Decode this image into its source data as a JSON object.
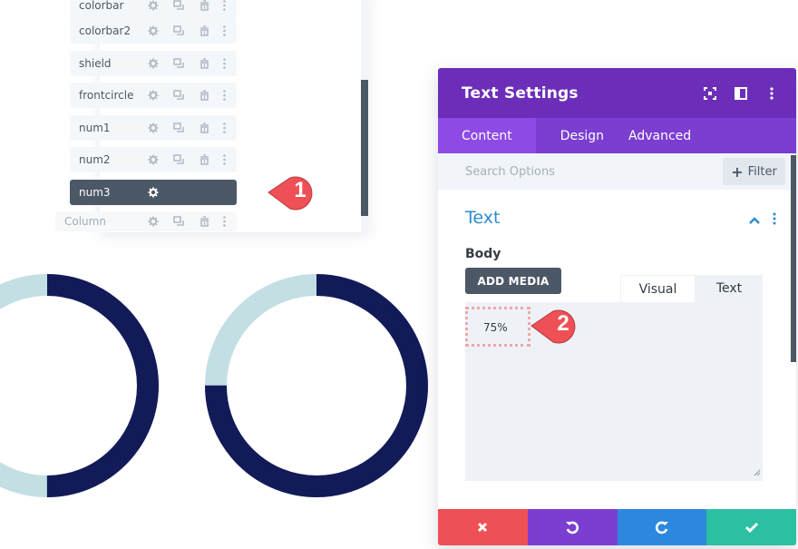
{
  "layers_panel": {
    "items": [
      {
        "label": "colorbar",
        "state": "partial"
      },
      {
        "label": "colorbar2",
        "state": "normal"
      },
      {
        "label": "shield",
        "state": "normal"
      },
      {
        "label": "frontcircle",
        "state": "normal"
      },
      {
        "label": "num1",
        "state": "normal"
      },
      {
        "label": "num2",
        "state": "normal"
      },
      {
        "label": "num3",
        "state": "active"
      },
      {
        "label": "Column",
        "state": "parent"
      }
    ],
    "row_icons": [
      "gear-icon",
      "duplicate-icon",
      "trash-icon",
      "more-vertical-icon"
    ]
  },
  "callouts": [
    {
      "number": "1",
      "color": "#ef5055"
    },
    {
      "number": "2",
      "color": "#ef5055"
    }
  ],
  "donuts": [
    {
      "name": "donut-left",
      "filled_fraction": 0.5,
      "fill_color": "#121b58",
      "track_color": "#c3dfe4"
    },
    {
      "name": "donut-right",
      "filled_fraction": 0.75,
      "fill_color": "#121b58",
      "track_color": "#c3dfe4"
    }
  ],
  "modal": {
    "title": "Text Settings",
    "header_icons": [
      "fullscreen-icon",
      "split-view-icon",
      "more-vertical-icon"
    ],
    "tabs": [
      {
        "label": "Content",
        "active": true
      },
      {
        "label": "Design",
        "active": false
      },
      {
        "label": "Advanced",
        "active": false
      }
    ],
    "search_placeholder": "Search Options",
    "filter_label": "Filter",
    "section_title": "Text",
    "body_label": "Body",
    "add_media_label": "ADD MEDIA",
    "editor_tabs": {
      "visual": "Visual",
      "text": "Text"
    },
    "body_value": "75%",
    "footer": {
      "cancel": "close-icon",
      "undo": "undo-icon",
      "redo": "redo-icon",
      "save": "check-icon"
    }
  },
  "colors": {
    "header_purple": "#6c2eb9",
    "tab_purple": "#7b3ed0",
    "accent_blue": "#2e8bd0",
    "cancel_red": "#ef5055",
    "redo_blue": "#2d87de",
    "save_green": "#2bc0a2"
  }
}
